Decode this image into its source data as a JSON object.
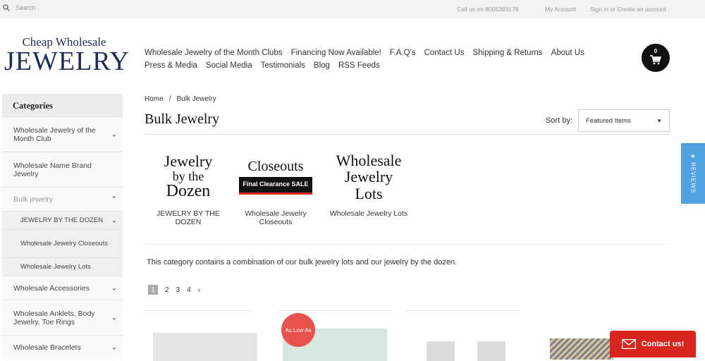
{
  "topbar": {
    "search_placeholder": "Search",
    "phone": "Call us on 8005393178",
    "account": "My Account",
    "signin": "Sign in or Create an account"
  },
  "logo": {
    "line1": "Cheap Wholesale",
    "line2": "JEWELRY"
  },
  "nav": {
    "row1": [
      "Wholesale Jewelry of the Month Clubs",
      "Financing Now Available!",
      "F.A.Q's",
      "Contact Us",
      "Shipping & Returns",
      "About Us"
    ],
    "row2": [
      "Press & Media",
      "Social Media",
      "Testimonials",
      "Blog",
      "RSS Feeds"
    ]
  },
  "cart": {
    "count": "0"
  },
  "sidebar": {
    "heading": "Categories",
    "items": [
      {
        "label": "Wholesale Jewelry of the Month Club",
        "chevron": "⌄"
      },
      {
        "label": "Wholesale Name Brand Jewelry",
        "chevron": ""
      },
      {
        "label": "Bulk jewelry",
        "chevron": "⌃"
      },
      {
        "label": "JEWELRY BY THE DOZEN",
        "chevron": "⌄"
      },
      {
        "label": "Wholesale Jewelry Closeouts",
        "chevron": ""
      },
      {
        "label": "Wholesale Jewelry Lots",
        "chevron": ""
      },
      {
        "label": "Wholesale Accessories",
        "chevron": "⌄"
      },
      {
        "label": "Wholesale Anklets, Body Jewelry, Toe Rings",
        "chevron": "⌄"
      },
      {
        "label": "Wholesale Bracelets",
        "chevron": "⌄"
      }
    ]
  },
  "breadcrumb": {
    "home": "Home",
    "sep": "/",
    "current": "Bulk Jewelry"
  },
  "page": {
    "title": "Bulk Jewelry",
    "sort_label": "Sort by:",
    "sort_value": "Featured Items",
    "description": "This category contains a combination of our bulk jewelry lots and our jewelry by the dozen."
  },
  "subcategories": [
    {
      "img_lines": [
        "Jewelry",
        "by the",
        "Dozen"
      ],
      "label": "JEWELRY BY THE DOZEN"
    },
    {
      "img_lines": [
        "Closeouts"
      ],
      "badge": "Final Clearance SALE",
      "label": "Wholesale Jewelry Closeouts"
    },
    {
      "img_lines": [
        "Wholesale",
        "Jewelry",
        "Lots"
      ],
      "label": "Wholesale Jewelry Lots"
    }
  ],
  "pagination": [
    "1",
    "2",
    "3",
    "4",
    "›"
  ],
  "product_badge": "As Low As",
  "reviews_tab": "★ REVIEWS",
  "contact_button": "Contact us!",
  "colors": {
    "accent_red": "#d8261e",
    "reviews_blue": "#4fa3e0",
    "logo_navy": "#1e2d5a"
  }
}
